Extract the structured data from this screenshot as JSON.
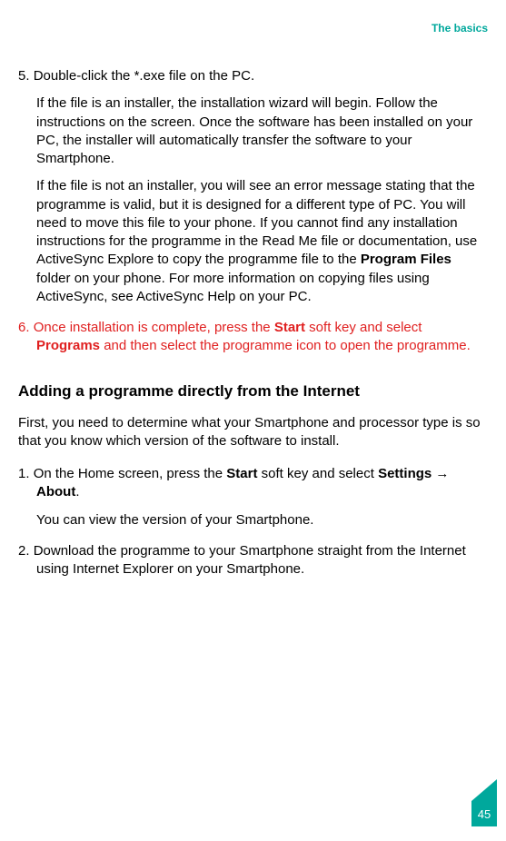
{
  "header": {
    "section_label": "The basics"
  },
  "steps_a": {
    "step5": {
      "num": "5.",
      "line1": "Double-click the *.exe file on the PC.",
      "para1_a": "If the file is an installer, the installation wizard will begin. Follow the instructions on the screen. Once the software has been installed on your PC, the installer will automatically transfer the software to your Smartphone.",
      "para2_a": "If the file is not an installer, you will see an error message stating that the programme is valid, but it is designed for a different type of PC. You will need to move this file to your phone. If you cannot find any installation instructions for the programme in the Read Me file or documentation, use ActiveSync Explore to copy the programme file to the ",
      "para2_bold": "Program Files",
      "para2_b": " folder on your phone. For more information on copying files using ActiveSync, see ActiveSync Help on your PC."
    },
    "step6": {
      "num": "6.",
      "text_a": "Once installation is complete, press the ",
      "bold1": "Start",
      "text_b": " soft key and select ",
      "bold2": "Programs",
      "text_c": " and then select the programme icon to open the programme."
    }
  },
  "section2": {
    "heading": "Adding a programme directly from the Internet",
    "intro": "First, you need to determine what your Smartphone and processor type is so that you know which version of the software to install.",
    "step1": {
      "num": "1.",
      "text_a": "On the Home screen, press the ",
      "bold1": "Start",
      "text_b": " soft key and select ",
      "bold2": "Settings",
      "arrow": " → ",
      "bold3": "About",
      "text_c": ".",
      "para": "You can view the version of your Smartphone."
    },
    "step2": {
      "num": "2.",
      "text": "Download the programme to your Smartphone straight from the Internet using Internet Explorer on your Smartphone."
    }
  },
  "footer": {
    "page_number": "45"
  }
}
